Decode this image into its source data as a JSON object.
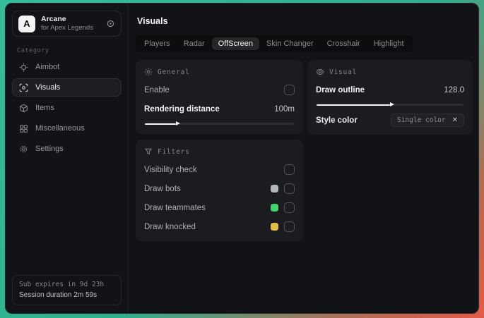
{
  "app": {
    "name": "Arcane",
    "subtitle": "for Apex Legends",
    "logo_letter": "A"
  },
  "sidebar": {
    "category_label": "Category",
    "items": [
      {
        "label": "Aimbot",
        "icon": "crosshair-icon",
        "selected": false
      },
      {
        "label": "Visuals",
        "icon": "scan-icon",
        "selected": true
      },
      {
        "label": "Items",
        "icon": "package-icon",
        "selected": false
      },
      {
        "label": "Miscellaneous",
        "icon": "layout-grid-icon",
        "selected": false
      },
      {
        "label": "Settings",
        "icon": "gear-icon",
        "selected": false
      }
    ],
    "subscription": {
      "expires": "Sub expires in 9d 23h",
      "session": "Session duration 2m 59s"
    }
  },
  "main": {
    "title": "Visuals",
    "tabs": [
      {
        "label": "Players",
        "selected": false
      },
      {
        "label": "Radar",
        "selected": false
      },
      {
        "label": "OffScreen",
        "selected": true
      },
      {
        "label": "Skin Changer",
        "selected": false
      },
      {
        "label": "Crosshair",
        "selected": false
      },
      {
        "label": "Highlight",
        "selected": false
      }
    ],
    "panels": {
      "general": {
        "title": "General",
        "icon": "sun-icon",
        "enable_label": "Enable",
        "enable_checked": false,
        "rendering_distance_label": "Rendering distance",
        "rendering_distance_value": "100m",
        "rendering_distance_fill_pct": 21
      },
      "visual": {
        "title": "Visual",
        "icon": "eye-icon",
        "draw_outline_label": "Draw outline",
        "draw_outline_value": "128.0",
        "draw_outline_fill_pct": 50,
        "style_color_label": "Style color",
        "style_color_chip": "Single color",
        "chip_close_glyph": "✕"
      },
      "filters": {
        "title": "Filters",
        "icon": "funnel-icon",
        "rows": [
          {
            "label": "Visibility check",
            "checked": false
          },
          {
            "label": "Draw bots",
            "swatch": "#b3b6ba",
            "checked": false
          },
          {
            "label": "Draw teammates",
            "swatch": "#45d36f",
            "checked": false
          },
          {
            "label": "Draw knocked",
            "swatch": "#e2bd4a",
            "checked": false
          }
        ]
      }
    }
  },
  "colors": {
    "backdrop_teal": "#35bd99",
    "backdrop_red": "#e25a49",
    "panel_bg": "#1a1c1f",
    "window_bg": "#121316",
    "accent_white": "#f2f3f4"
  }
}
